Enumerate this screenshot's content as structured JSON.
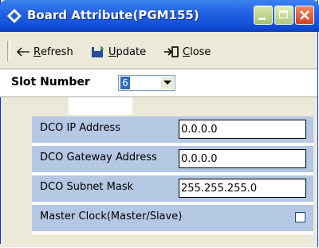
{
  "window": {
    "title": "Board Attribute(PGM155)"
  },
  "toolbar": {
    "refresh_prefix": "",
    "refresh_mnemonic": "R",
    "refresh_rest": "efresh",
    "update_mnemonic": "U",
    "update_rest": "pdate",
    "close_mnemonic": "C",
    "close_rest": "lose"
  },
  "slot": {
    "label": "Slot Number",
    "value": "6"
  },
  "fields": [
    {
      "label": "DCO IP Address",
      "value": "0.0.0.0"
    },
    {
      "label": "DCO Gateway Address",
      "value": "0.0.0.0"
    },
    {
      "label": "DCO Subnet Mask",
      "value": "255.255.255.0"
    }
  ],
  "master_clock": {
    "label": "Master Clock(Master/Slave)",
    "checked": false
  },
  "colors": {
    "titlebar": "#1F5FE0",
    "row_bg": "#B4C8E4",
    "window_bg": "#ECE9D8"
  }
}
